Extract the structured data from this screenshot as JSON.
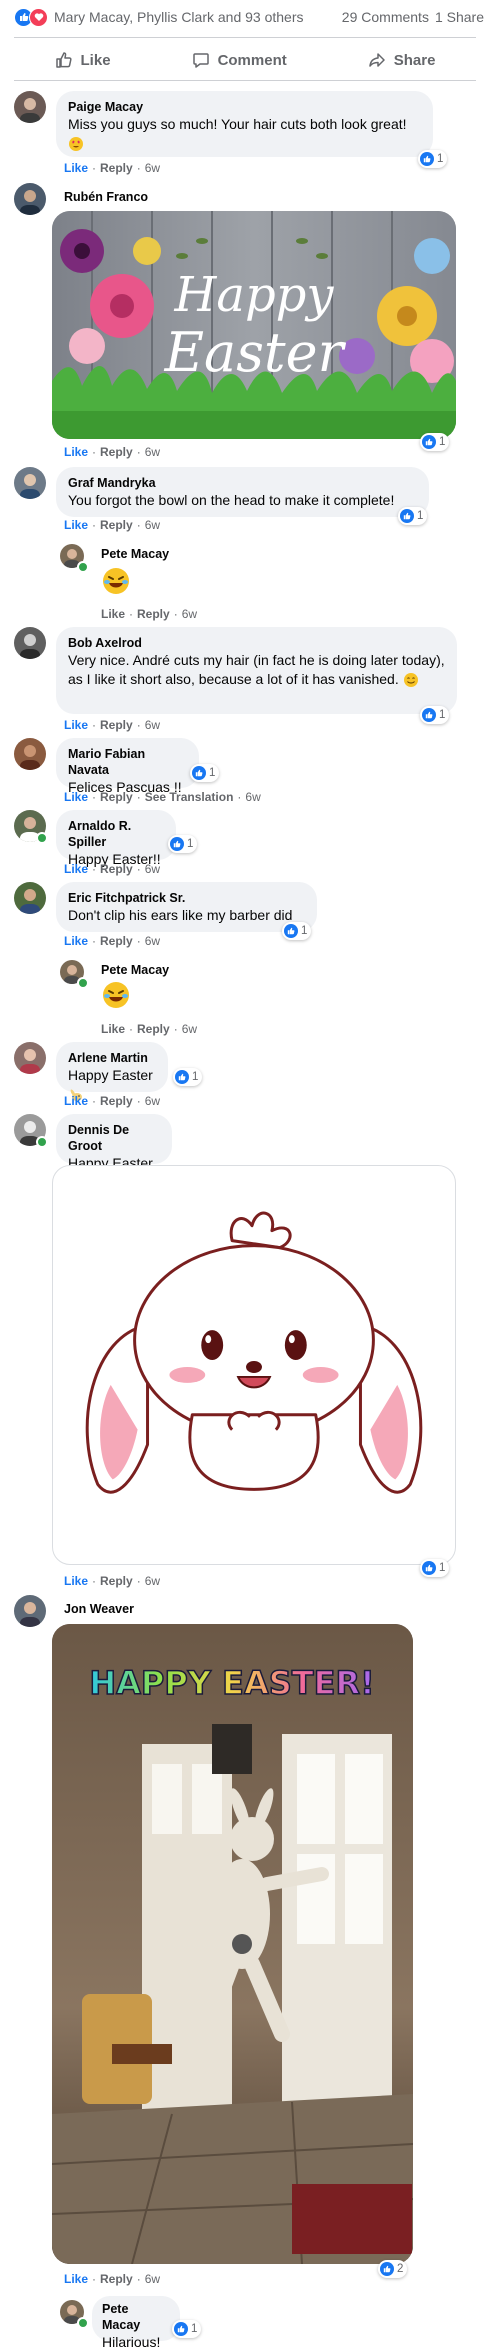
{
  "summary": {
    "names": "Mary Macay, Phyllis Clark and 93 others",
    "comments": "29 Comments",
    "shares": "1 Share"
  },
  "actions": {
    "like": "Like",
    "comment": "Comment",
    "share": "Share"
  },
  "labels": {
    "like": "Like",
    "reply": "Reply",
    "translation": "See Translation",
    "dot": "·"
  },
  "colors": {
    "accent": "#1877f2",
    "bubble": "#f0f2f5",
    "meta": "#65676b"
  },
  "comments": [
    {
      "name": "Paige Macay",
      "text": "Miss you guys so much! Your hair cuts both look great!",
      "time": "6w",
      "likes": "1"
    },
    {
      "name": "Rubén Franco",
      "image_text_1": "Happy",
      "image_text_2": "Easter",
      "time": "6w",
      "likes": "1"
    },
    {
      "name": "Graf Mandryka",
      "text": "You forgot the bowl on the head to make it complete!",
      "time": "6w",
      "likes": "1"
    },
    {
      "name": "Pete Macay",
      "time": "6w"
    },
    {
      "name": "Bob Axelrod",
      "text": "Very nice. André cuts my hair (in fact he is doing later today), as I like it short also, because a lot of it has vanished.",
      "time": "6w",
      "likes": "1"
    },
    {
      "name": "Mario Fabian Navata",
      "text": "Felices Pascuas !!",
      "time": "6w",
      "likes": "1"
    },
    {
      "name": "Arnaldo R. Spiller",
      "text": "Happy Easter!!",
      "time": "6w",
      "likes": "1"
    },
    {
      "name": "Eric Fitchpatrick Sr.",
      "text": "Don't clip his ears like my barber did",
      "time": "6w",
      "likes": "1"
    },
    {
      "name": "Pete Macay",
      "time": "6w"
    },
    {
      "name": "Arlene Martin",
      "text": "Happy Easter",
      "time": "6w",
      "likes": "1"
    },
    {
      "name": "Dennis De Groot",
      "text": "Happy Easter",
      "time": "6w",
      "likes": "1"
    },
    {
      "name": "Jon Weaver",
      "gif_text": "HAPPY EASTER!",
      "time": "6w",
      "likes": "2"
    },
    {
      "name": "Pete Macay",
      "text": "Hilarious!",
      "likes": "1"
    }
  ]
}
